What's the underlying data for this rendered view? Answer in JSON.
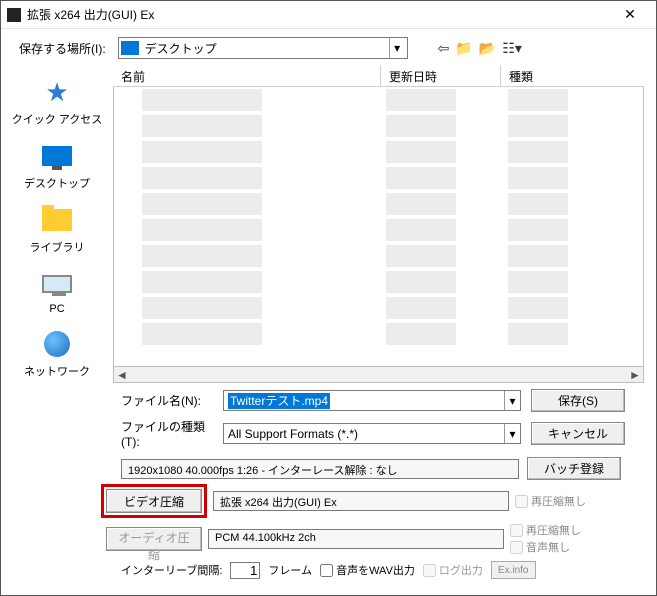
{
  "window": {
    "title": "拡張 x264 出力(GUI) Ex"
  },
  "toolbar": {
    "save_in_label": "保存する場所(I):",
    "location": "デスクトップ"
  },
  "sidebar": {
    "items": [
      {
        "label": "クイック アクセス"
      },
      {
        "label": "デスクトップ"
      },
      {
        "label": "ライブラリ"
      },
      {
        "label": "PC"
      },
      {
        "label": "ネットワーク"
      }
    ]
  },
  "columns": {
    "name": "名前",
    "date": "更新日時",
    "type": "種類"
  },
  "form": {
    "filename_label": "ファイル名(N):",
    "filename_value": "Twitterテスト.mp4",
    "filetype_label": "ファイルの種類(T):",
    "filetype_value": "All Support Formats (*.*)",
    "save_btn": "保存(S)",
    "cancel_btn": "キャンセル"
  },
  "info": {
    "video_line": "1920x1080  40.000fps  1:26  -  インターレース解除 : なし",
    "batch_btn": "バッチ登録",
    "video_btn": "ビデオ圧縮",
    "video_codec": "拡張 x264 出力(GUI) Ex",
    "audio_btn": "オーディオ圧縮",
    "audio_codec": "PCM 44.100kHz 2ch",
    "no_recompress": "再圧縮無し",
    "no_audio": "音声無し"
  },
  "bottom": {
    "interleave_label": "インターリーブ間隔:",
    "interleave_value": "1",
    "frame_unit": "フレーム",
    "wav_out": "音声をWAV出力",
    "log_out": "ログ出力",
    "exinfo": "Ex.info"
  }
}
